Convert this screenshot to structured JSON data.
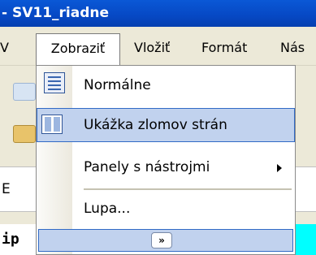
{
  "window": {
    "title": "- SV11_riadne"
  },
  "menubar": {
    "items": [
      {
        "label": "V"
      },
      {
        "label": "Zobraziť"
      },
      {
        "label": "Vložiť"
      },
      {
        "label": "Formát"
      },
      {
        "label": "Nás"
      }
    ]
  },
  "behind": {
    "cell_text": "E",
    "row_text": "ip"
  },
  "dropdown": {
    "items": [
      {
        "label": "Normálne",
        "icon": "normal-view-icon"
      },
      {
        "label": "Ukážka zlomov strán",
        "icon": "page-break-preview-icon",
        "highlighted": true
      },
      {
        "label": "Panely s nástrojmi",
        "has_submenu": true
      },
      {
        "label": "Lupa..."
      }
    ],
    "expand_label": "»"
  },
  "colors": {
    "titlebar": "#0648c4",
    "menubar": "#ece9d8",
    "highlight": "#c1d2ee",
    "highlight_border": "#316ac5"
  }
}
